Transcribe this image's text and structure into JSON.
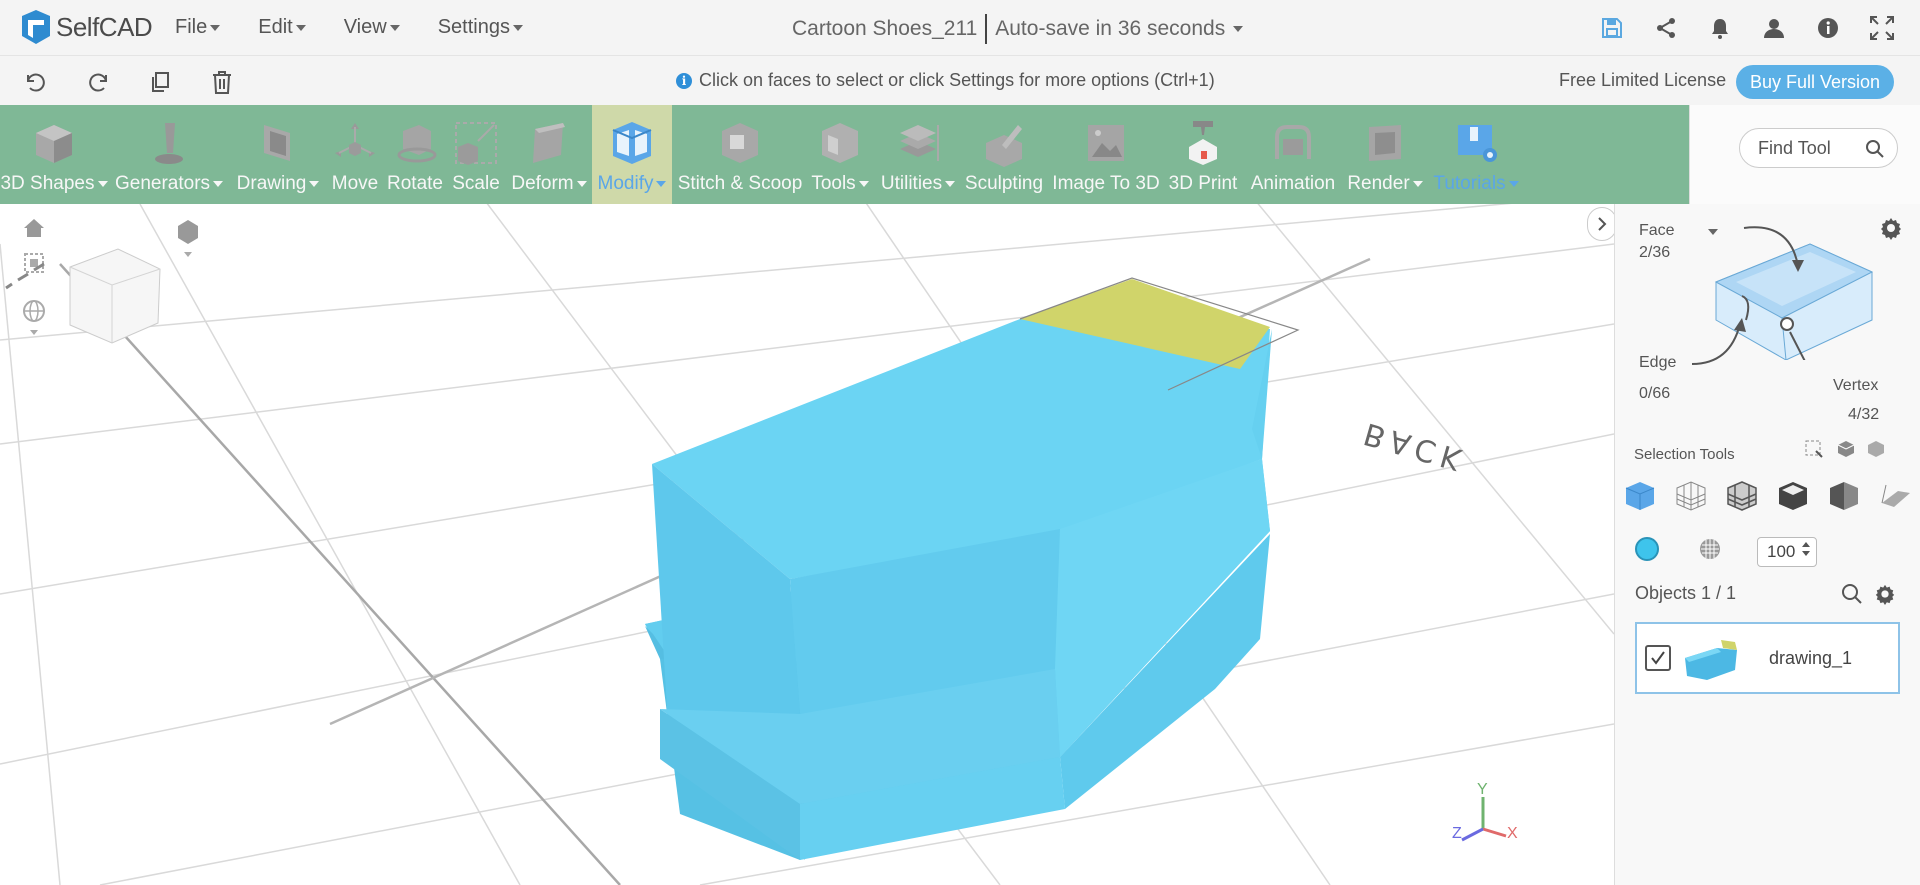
{
  "app": {
    "brand": "SelfCAD"
  },
  "menu": [
    {
      "label": "File"
    },
    {
      "label": "Edit"
    },
    {
      "label": "View"
    },
    {
      "label": "Settings"
    }
  ],
  "project": {
    "name": "Cartoon Shoes_211",
    "autosave": "Auto-save in 36 seconds"
  },
  "top_icons": [
    "save-icon",
    "share-icon",
    "bell-icon",
    "user-icon",
    "info-icon",
    "fullscreen-icon"
  ],
  "subbar": {
    "hint": "Click on faces to select or click Settings for more options (Ctrl+1)",
    "license": "Free Limited License",
    "buy_label": "Buy Full Version"
  },
  "toolbar": [
    {
      "label": "3D Shapes",
      "dropdown": true
    },
    {
      "label": "Generators",
      "dropdown": true
    },
    {
      "label": "Drawing",
      "dropdown": true
    },
    {
      "label": "Move",
      "dropdown": false
    },
    {
      "label": "Rotate",
      "dropdown": false
    },
    {
      "label": "Scale",
      "dropdown": false
    },
    {
      "label": "Deform",
      "dropdown": true
    },
    {
      "label": "Modify",
      "dropdown": true,
      "active": true
    },
    {
      "label": "Stitch & Scoop",
      "dropdown": false
    },
    {
      "label": "Tools",
      "dropdown": true
    },
    {
      "label": "Utilities",
      "dropdown": true
    },
    {
      "label": "Sculpting",
      "dropdown": false
    },
    {
      "label": "Image To 3D",
      "dropdown": false
    },
    {
      "label": "3D Print",
      "dropdown": false
    },
    {
      "label": "Animation",
      "dropdown": false
    },
    {
      "label": "Render",
      "dropdown": true
    },
    {
      "label": "Tutorials",
      "dropdown": true
    }
  ],
  "find_tool": {
    "placeholder": "Find Tool"
  },
  "viewport": {
    "back_label": "BACK",
    "axes": {
      "y": "Y",
      "z": "Z",
      "x": "X"
    }
  },
  "panel": {
    "face_label": "Face",
    "face_count": "2/36",
    "edge_label": "Edge",
    "edge_count": "0/66",
    "vertex_label": "Vertex",
    "vertex_count": "4/32",
    "selection_tools": "Selection Tools",
    "opacity": "100",
    "objects_label": "Objects 1 / 1",
    "object_name": "drawing_1"
  },
  "colors": {
    "toolbar_bg": "#7fb896",
    "active_tool_bg": "#cfd9a9",
    "accent_blue": "#5bb0e6",
    "model_blue": "#6ad3f2",
    "selected_face": "#d0d46a"
  }
}
